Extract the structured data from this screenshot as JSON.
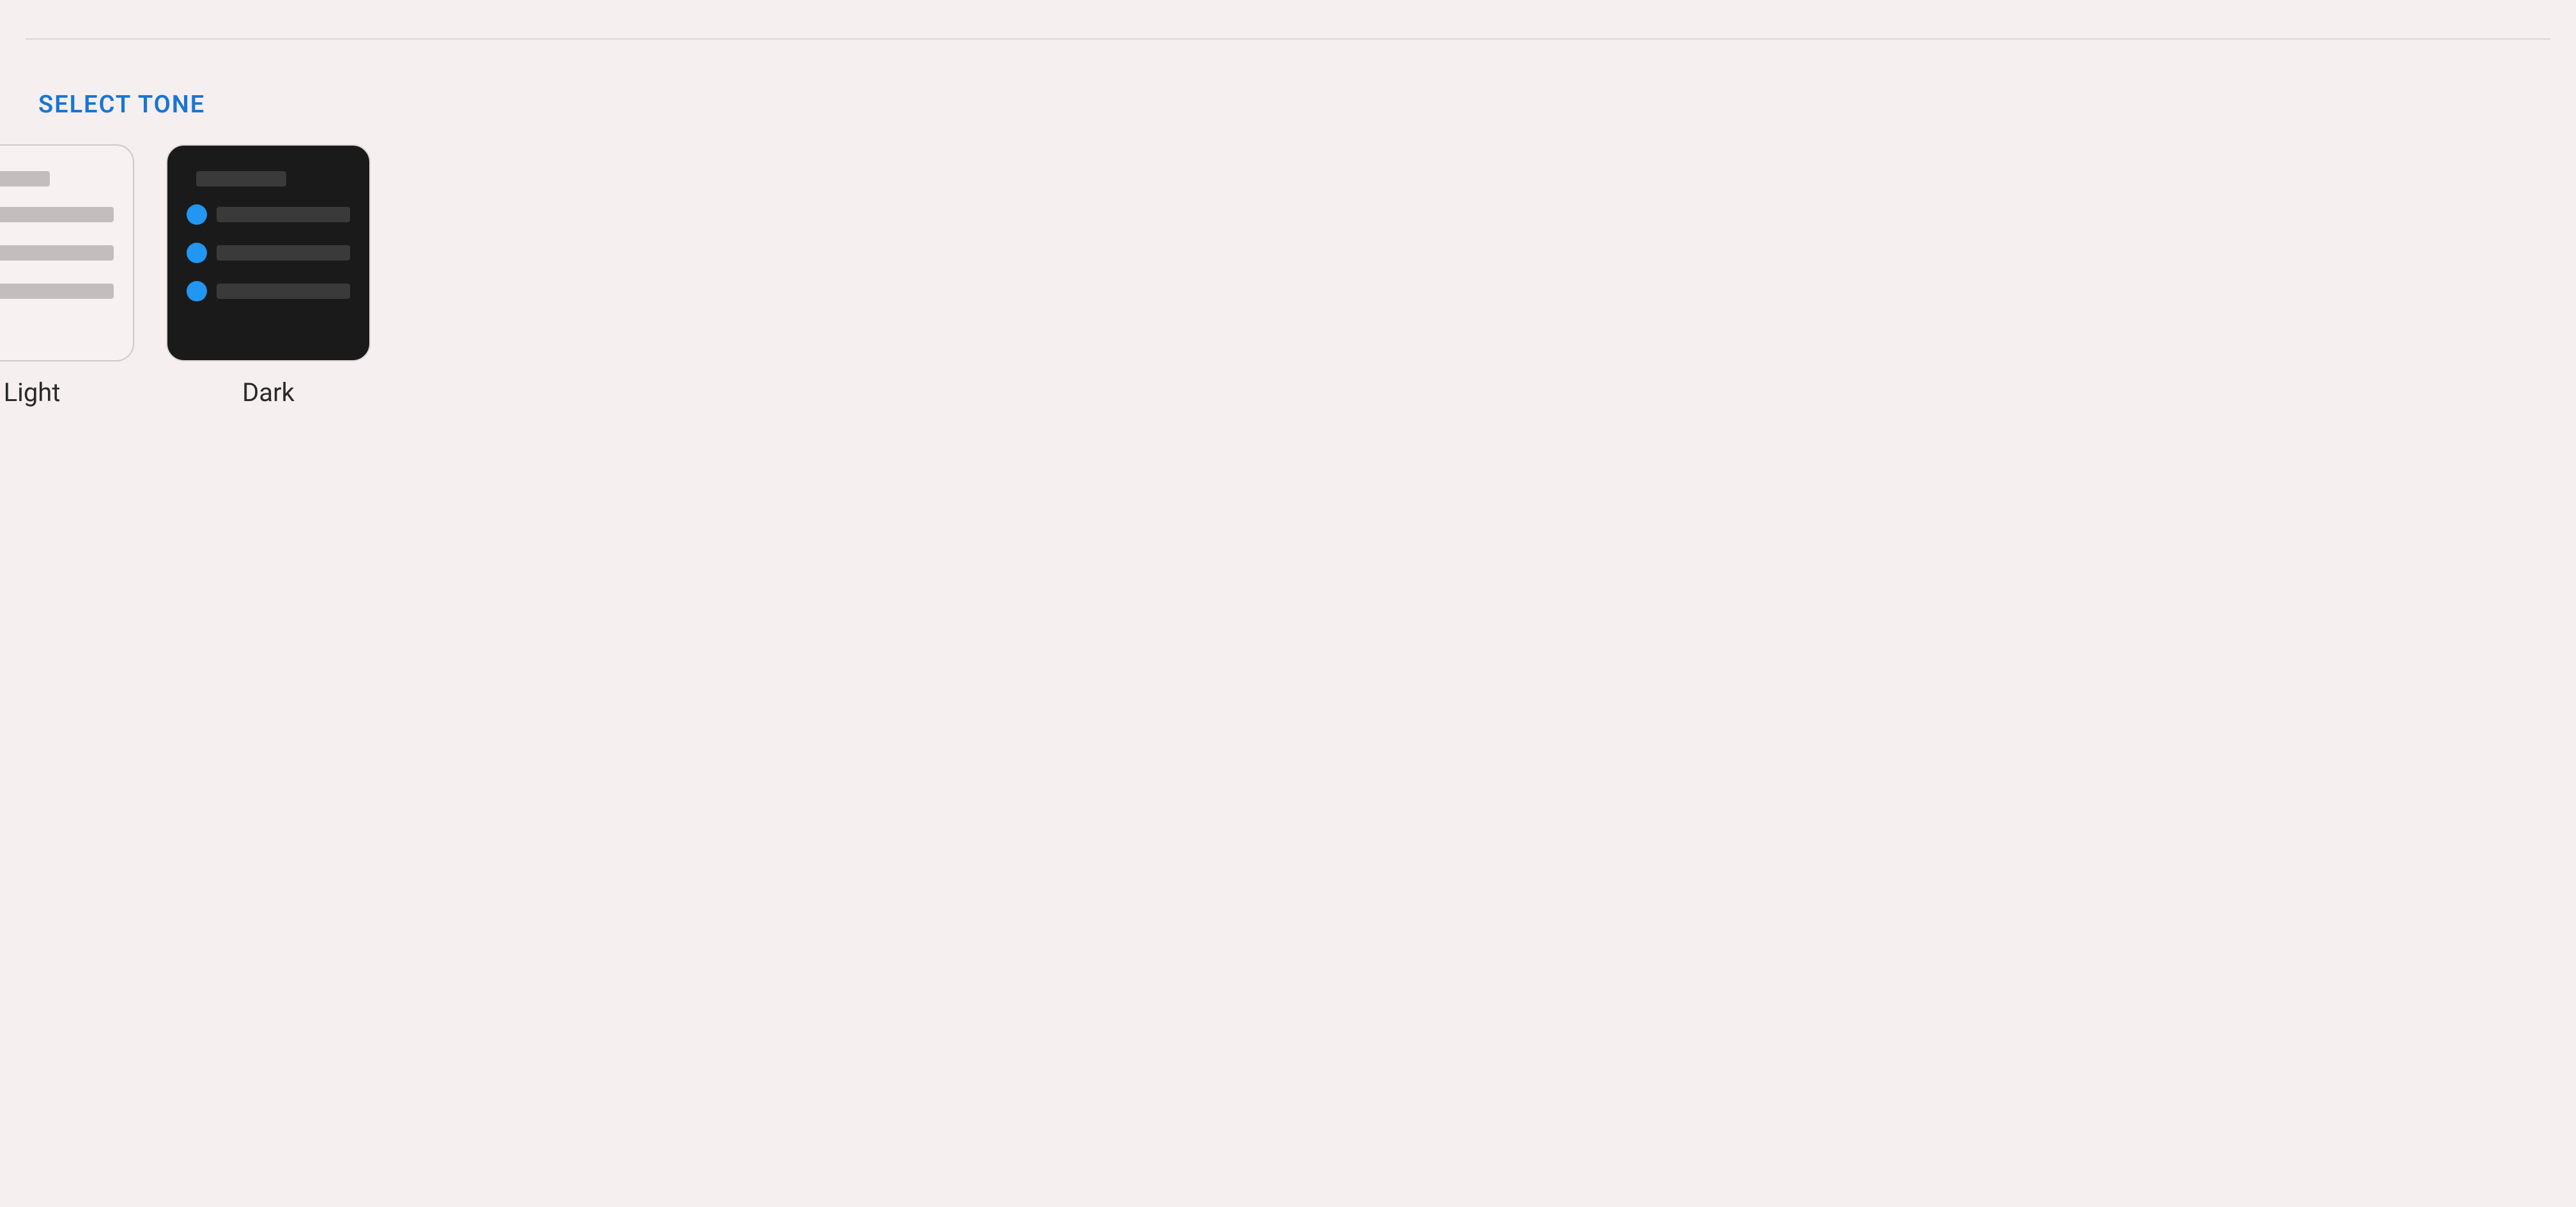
{
  "section": {
    "title": "SELECT TONE"
  },
  "tones": {
    "options": [
      {
        "label": "Light"
      },
      {
        "label": "Dark"
      }
    ]
  },
  "colors": {
    "accent": "#1976D2",
    "accent_dark": "#2196F3"
  }
}
